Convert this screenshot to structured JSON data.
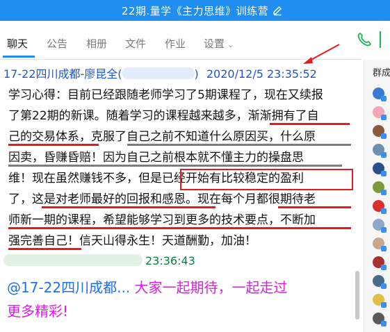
{
  "window": {
    "title": "22期.量学《主力思维》训练营"
  },
  "tabs": [
    {
      "label": "聊天",
      "active": true
    },
    {
      "label": "公告"
    },
    {
      "label": "相册"
    },
    {
      "label": "文件"
    },
    {
      "label": "作业"
    },
    {
      "label": "设置"
    }
  ],
  "right_panel": {
    "title": "群成"
  },
  "message1": {
    "sender": "17-22四川成都-廖昆全(",
    "sender_suffix": ")",
    "timestamp": "2020/12/5 23:35:52",
    "lines": [
      "学习心得：目前已经跟随老师学习了5期课程了，现在又续报",
      "了第22期的新课。随着学习的课程越来越多，渐渐拥有了自",
      "己的交易体系，克服了自己之前不知道什么原因买，什么原",
      "因卖，昏赚昏赔！因为自己之前根本就不懂主力的操盘思",
      "维！现在虽然赚钱不多，但是已经开始有比较稳定的盈利",
      "了，这是对老师最好的回报和感恩。现在每个月都很期待老",
      "师新一期的课程，希望能够学习到更多的技术要点，不断加",
      "强完善自己！信天山得永生！天道酬勤，加油！"
    ]
  },
  "message2": {
    "timestamp": "23:36:43",
    "mention": "@17-22四川成都...",
    "text_line1": " 大家一起期待，一起走过",
    "text_line2": "更多精彩!"
  },
  "colors": {
    "title_bar": "#1f8ef0",
    "sender": "#1d55c8",
    "timestamp2": "#0d7e3e",
    "mention": "#1f6ff0",
    "cheer": "#d81ee0",
    "highlight_red": "#e61a1a",
    "highlight_gray": "#7d7d7d"
  },
  "icons": [
    "edit-icon",
    "phone-icon",
    "red-arrow-annotation"
  ]
}
